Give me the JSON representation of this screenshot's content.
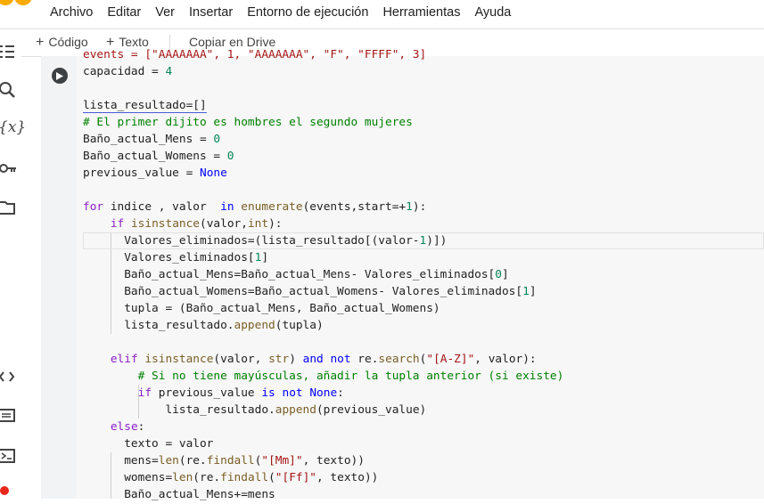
{
  "menu": [
    "Archivo",
    "Editar",
    "Ver",
    "Insertar",
    "Entorno de ejecución",
    "Herramientas",
    "Ayuda"
  ],
  "toolbar": {
    "code_label": "Código",
    "text_label": "Texto",
    "drive_label": "Copiar en Drive"
  },
  "sidebar_icons": [
    "table-of-contents-icon",
    "search-icon",
    "variables-icon",
    "key-icon",
    "folder-icon",
    "code-snippets-icon",
    "command-palette-icon",
    "terminal-icon"
  ],
  "code": {
    "line0": "events = [\"AAAAAAA\", 1, \"AAAAAAA\", \"F\", \"FFFF\", 3]",
    "line1": "capacidad = 4",
    "line2": "",
    "line3": "lista_resultado=[]",
    "line4": "# El primer dijito es hombres el segundo mujeres",
    "line5": "Baño_actual_Mens = 0",
    "line6": "Baño_actual_Womens = 0",
    "line7": "previous_value = None",
    "line8": "",
    "line9": "for indice , valor  in enumerate(events,start=+1):",
    "line10": "    if isinstance(valor,int):",
    "line11": "      Valores_eliminados=(lista_resultado[(valor-1)])",
    "line12": "      Valores_eliminados[1]",
    "line13": "      Baño_actual_Mens=Baño_actual_Mens- Valores_eliminados[0]",
    "line14": "      Baño_actual_Womens=Baño_actual_Womens- Valores_eliminados[1]",
    "line15": "      tupla = (Baño_actual_Mens, Baño_actual_Womens)",
    "line16": "      lista_resultado.append(tupla)",
    "line17": "",
    "line18": "    elif isinstance(valor, str) and not re.search(\"[A-Z]\", valor):",
    "line19": "        # Si no tiene mayúsculas, añadir la tupla anterior (si existe)",
    "line20": "        if previous_value is not None:",
    "line21": "            lista_resultado.append(previous_value)",
    "line22": "    else:",
    "line23": "      texto = valor",
    "line24": "      mens=len(re.findall(\"[Mm]\", texto))",
    "line25": "      womens=len(re.findall(\"[Ff]\", texto))",
    "line26": "      Baño_actual_Mens+=mens"
  },
  "colors": {
    "keyword": "#0000ff",
    "control": "#8b20c6",
    "builtin": "#795e26",
    "string": "#a31515",
    "number": "#098658",
    "comment": "#008000"
  }
}
